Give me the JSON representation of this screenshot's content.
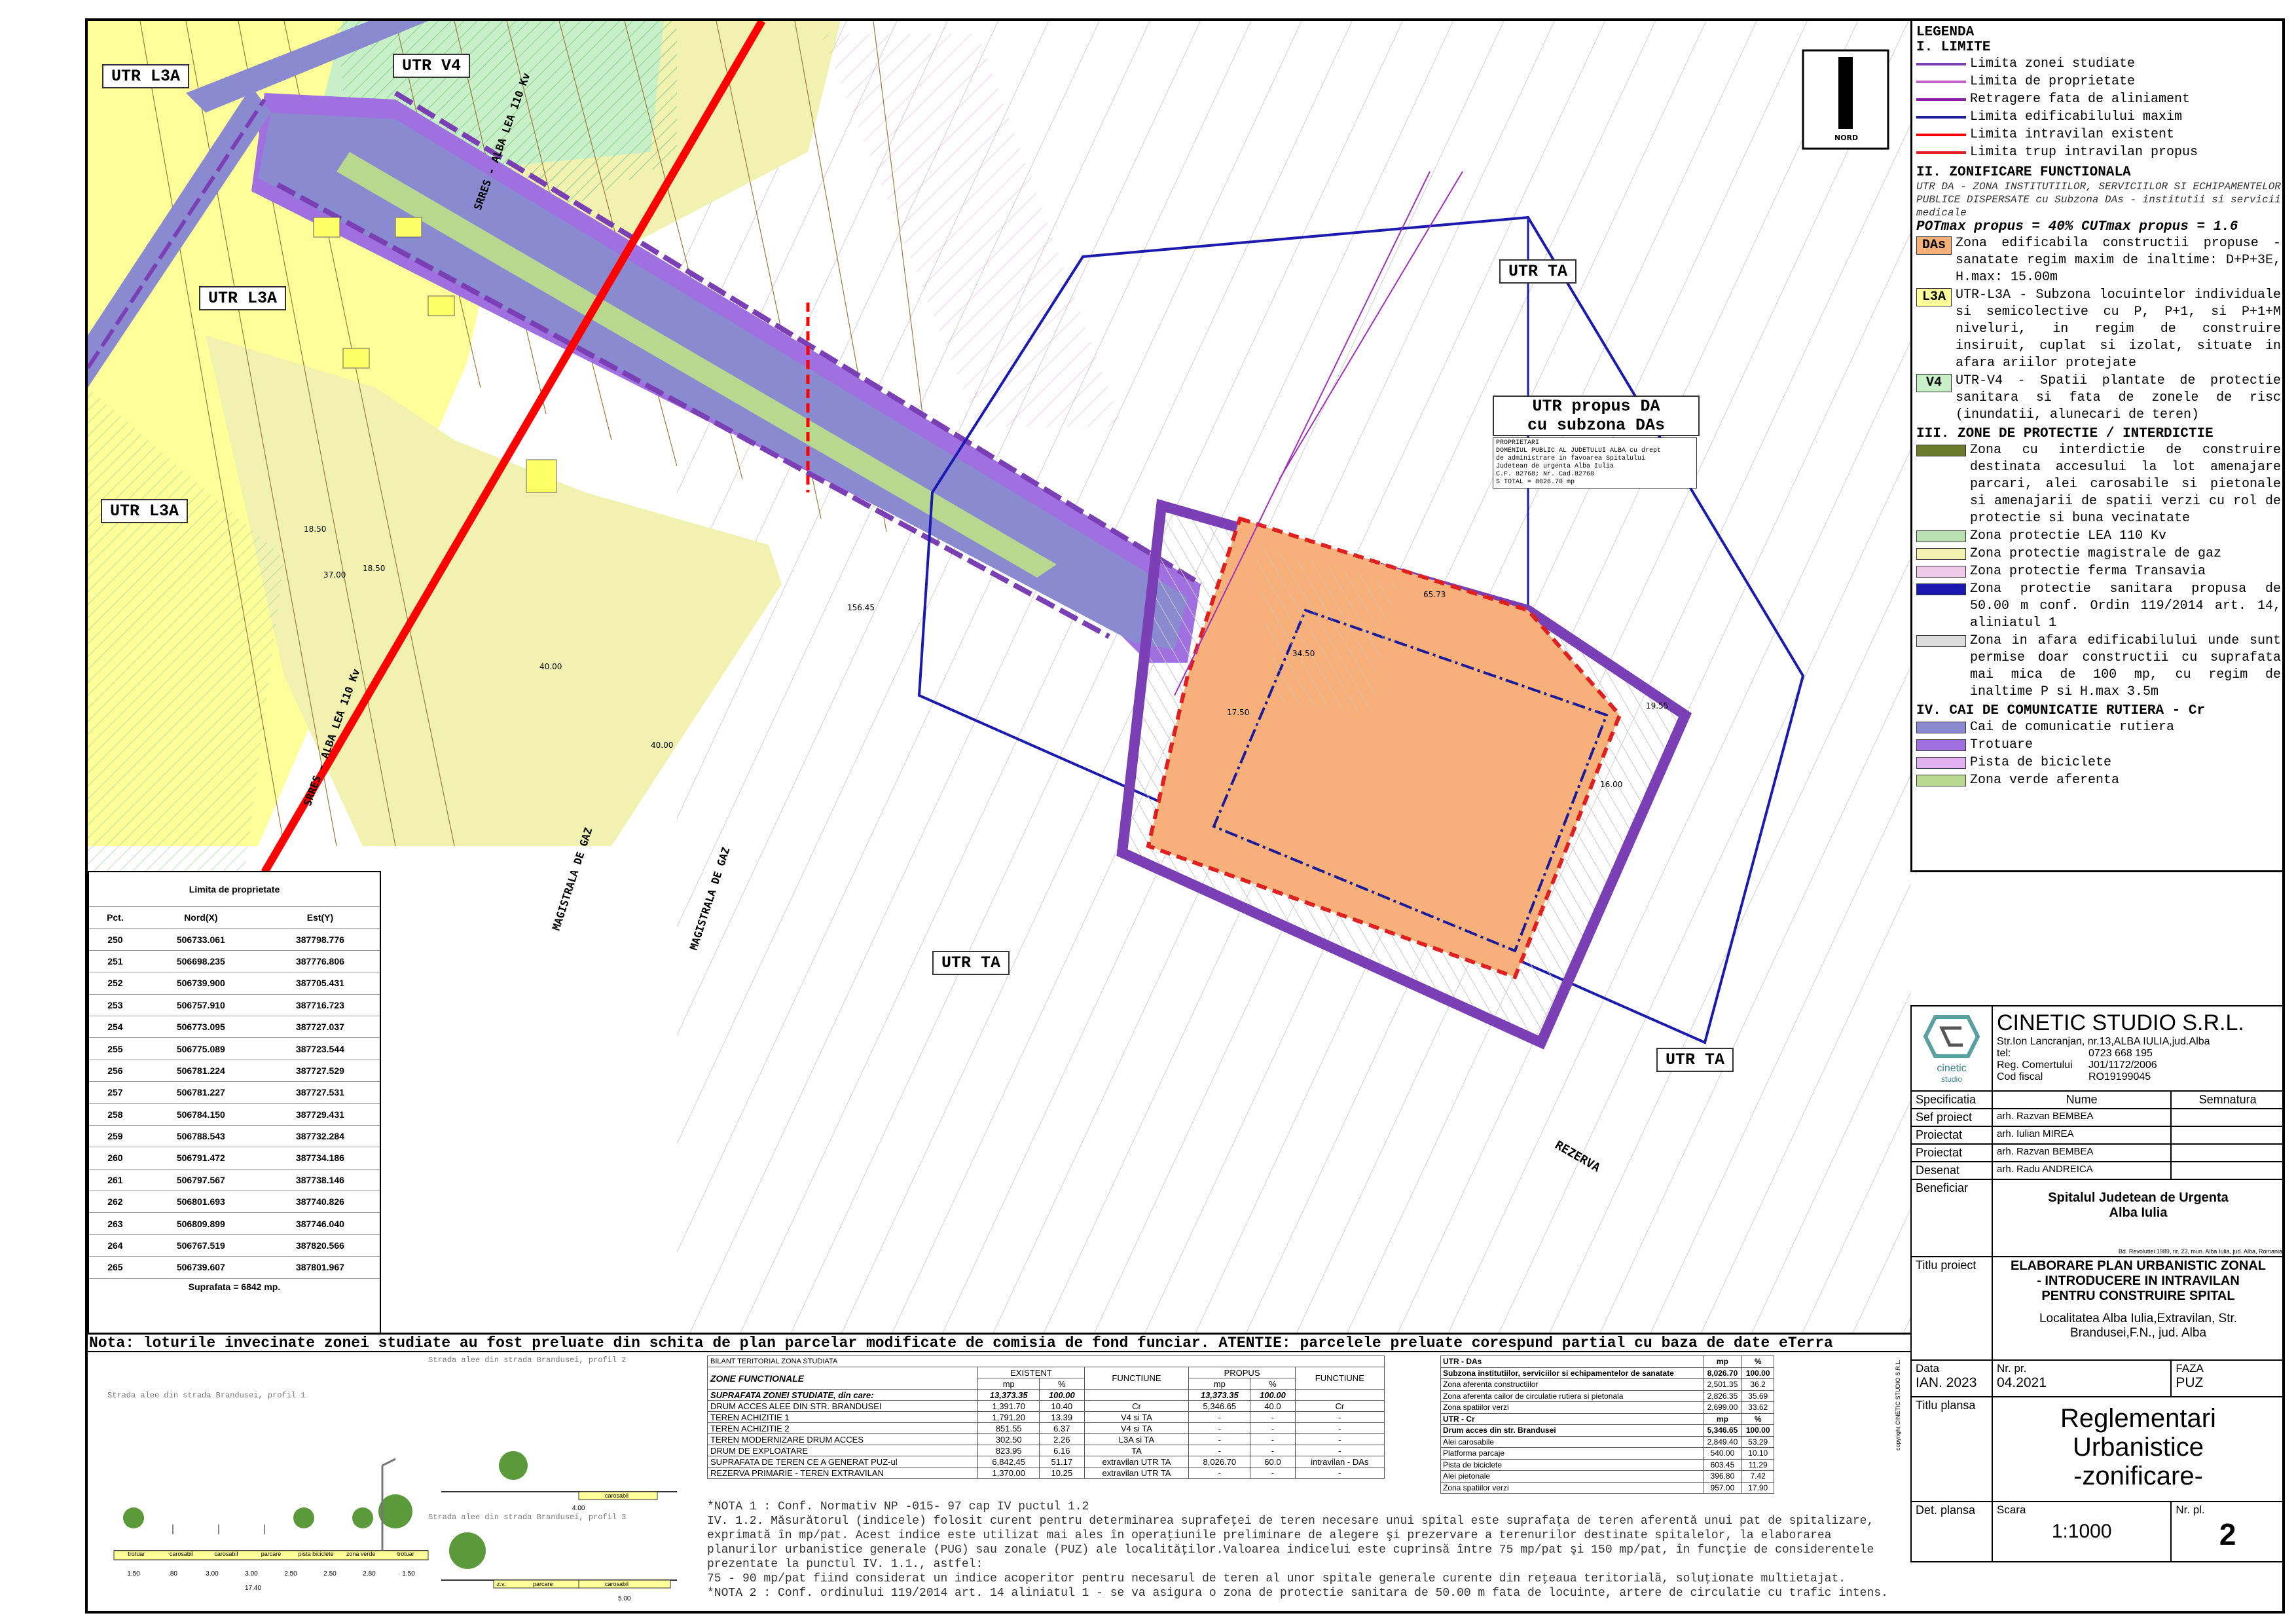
{
  "map": {
    "utr_labels": [
      "UTR L3A",
      "UTR V4",
      "UTR L3A",
      "UTR L3A",
      "UTR TA",
      "UTR TA",
      "UTR TA"
    ],
    "utr_propus": [
      "UTR propus DA",
      "cu subzona DAs"
    ],
    "owner_note": [
      "PROPRIETARI",
      "DOMENIUL PUBLIC AL JUDETULUI ALBA cu drept",
      "de administrare in favoarea Spitalului",
      "Judetean de urgenta Alba Iulia",
      "C.F. 82768; Nr. Cad.82768",
      "S TOTAL = 8026.70 mp"
    ],
    "line_labels": [
      "SRRES - ALBA LEA 110 Kv",
      "SRRES - ALBA LEA 110 Kv",
      "MAGISTRALA DE GAZ",
      "MAGISTRALA DE GAZ"
    ],
    "rezerva": "REZERVA",
    "north": "NORD",
    "dims": [
      "18.50",
      "37.00",
      "18.50",
      "40.00",
      "40.00",
      "34.50",
      "17.50",
      "19.55",
      "16.00",
      "156.45",
      "65.73"
    ]
  },
  "legend": {
    "title": "LEGENDA",
    "s1": "I. LIMITE",
    "limits": [
      {
        "label": "Limita zonei studiate",
        "color": "#7b3fb5"
      },
      {
        "label": "Limita de proprietate",
        "color": "#c060c8"
      },
      {
        "label": "Retragere fata de aliniament",
        "color": "#8b1fa8"
      },
      {
        "label": "Limita edificabilului maxim",
        "color": "#1a1a9a"
      },
      {
        "label": "Limita intravilan existent",
        "color": "#ff0000"
      },
      {
        "label": "Limita trup intravilan propus",
        "color": "#e02020"
      }
    ],
    "s2": "II. ZONIFICARE FUNCTIONALA",
    "s2_desc": "UTR DA - ZONA  INSTITUTIILOR, SERVICIILOR SI ECHIPAMENTELOR PUBLICE DISPERSATE cu Subzona DAs - institutii si servicii medicale",
    "pot": "POTmax propus = 40% CUTmax propus = 1.6",
    "zones": [
      {
        "code": "DAs",
        "label": "Zona edificabila constructii propuse - sanatate regim maxim de inaltime: D+P+3E, H.max: 15.00m",
        "color": "#f7b07a"
      },
      {
        "code": "L3A",
        "label": "UTR-L3A - Subzona locuintelor individuale si semicolective cu P, P+1, si P+1+M niveluri, in regim de construire insiruit, cuplat si izolat, situate in afara ariilor protejate",
        "color": "#ffff99"
      },
      {
        "code": "V4",
        "label": "UTR-V4 - Spatii plantate de protectie sanitara si fata de zonele de risc (inundatii, alunecari de teren)",
        "color": "#c8f0c8"
      }
    ],
    "s3": "III. ZONE DE PROTECTIE / INTERDICTIE",
    "protect": [
      {
        "label": "Zona cu interdictie de construire destinata accesului la lot amenajare parcari, alei carosabile si pietonale si amenajarii de spatii verzi cu rol de protectie si buna vecinatate",
        "color": "#6b7a2a"
      },
      {
        "label": "Zona protectie LEA 110 Kv",
        "color": "#b8e0b0"
      },
      {
        "label": "Zona protectie magistrale de gaz",
        "color": "#f2f2b0"
      },
      {
        "label": "Zona protectie ferma Transavia",
        "color": "#f0c8e8"
      },
      {
        "label": "Zona protectie sanitara propusa de 50.00 m conf. Ordin 119/2014 art. 14, aliniatul 1",
        "color": "#1a1ab0"
      },
      {
        "label": "Zona in afara edificabilului unde sunt permise doar constructii cu suprafata mai mica de 100 mp, cu regim de inaltime P si H.max 3.5m",
        "color": "#dddddd"
      }
    ],
    "s4": "IV. CAI DE COMUNICATIE RUTIERA - Cr",
    "roads": [
      {
        "label": "Cai de comunicatie rutiera",
        "color": "#8a8ad0"
      },
      {
        "label": "Trotuare",
        "color": "#a070e0"
      },
      {
        "label": "Pista de biciclete",
        "color": "#e0b0f0"
      },
      {
        "label": "Zona verde aferenta",
        "color": "#b8d890"
      }
    ]
  },
  "coords": {
    "title": "Limita de proprietate",
    "headers": [
      "Pct.",
      "Nord(X)",
      "Est(Y)"
    ],
    "rows": [
      [
        "250",
        "506733.061",
        "387798.776"
      ],
      [
        "251",
        "506698.235",
        "387776.806"
      ],
      [
        "252",
        "506739.900",
        "387705.431"
      ],
      [
        "253",
        "506757.910",
        "387716.723"
      ],
      [
        "254",
        "506773.095",
        "387727.037"
      ],
      [
        "255",
        "506775.089",
        "387723.544"
      ],
      [
        "256",
        "506781.224",
        "387727.529"
      ],
      [
        "257",
        "506781.227",
        "387727.531"
      ],
      [
        "258",
        "506784.150",
        "387729.431"
      ],
      [
        "259",
        "506788.543",
        "387732.284"
      ],
      [
        "260",
        "506791.472",
        "387734.186"
      ],
      [
        "261",
        "506797.567",
        "387738.146"
      ],
      [
        "262",
        "506801.693",
        "387740.826"
      ],
      [
        "263",
        "506809.899",
        "387746.040"
      ],
      [
        "264",
        "506767.519",
        "387820.566"
      ],
      [
        "265",
        "506739.607",
        "387801.967"
      ]
    ],
    "total": "Suprafata = 6842 mp."
  },
  "note_line": "Nota: loturile invecinate zonei studiate au fost preluate din schita de plan parcelar modificate de comisia de fond funciar. ATENTIE: parcelele preluate corespund partial cu baza de date eTerra",
  "profiles": {
    "p1_title": "Strada alee din strada Brandusei, profil 1",
    "p2_title": "Strada alee din strada Brandusei, profil 2",
    "p3_title": "Strada alee din strada Brandusei, profil 3",
    "p1_labels": [
      "trotuar",
      "carosabil",
      "carosabil",
      "parcare",
      "pista biciclete",
      "zona verde",
      "trotuar"
    ],
    "p1_dims": [
      "1.50",
      ".80",
      "3.00",
      "3.00",
      "2.50",
      "2.50",
      "2.80",
      "1.50"
    ],
    "p1_total": "17.40",
    "p2_label": "carosabil",
    "p2_dim": "4.00",
    "p3_labels": [
      "z.v.",
      "parcare",
      "carosabil"
    ],
    "p3_dim": "5.00"
  },
  "bilant": {
    "title": "BILANT TERITORIAL ZONA STUDIATA",
    "zone_head": "ZONE FUNCTIONALE",
    "cols": [
      "EXISTENT",
      "FUNCTIUNE",
      "PROPUS",
      "FUNCTIUNE"
    ],
    "units": [
      "mp",
      "%",
      "mp",
      "%"
    ],
    "rows": [
      [
        "SUPRAFATA ZONEI STUDIATE, din care:",
        "13,373.35",
        "100.00",
        "",
        "13,373.35",
        "100.00",
        ""
      ],
      [
        "DRUM ACCES ALEE DIN STR. BRANDUSEI",
        "1,391.70",
        "10.40",
        "Cr",
        "5,346.65",
        "40.0",
        "Cr"
      ],
      [
        "TEREN ACHIZITIE 1",
        "1,791.20",
        "13.39",
        "V4 si TA",
        "-",
        "-",
        "-"
      ],
      [
        "TEREN ACHIZITIE 2",
        "851.55",
        "6.37",
        "V4 si TA",
        "-",
        "-",
        "-"
      ],
      [
        "TEREN MODERNIZARE DRUM ACCES",
        "302.50",
        "2.26",
        "L3A si TA",
        "-",
        "-",
        "-"
      ],
      [
        "DRUM DE EXPLOATARE",
        "823.95",
        "6.16",
        "TA",
        "-",
        "-",
        "-"
      ],
      [
        "SUPRAFATA DE TEREN CE A GENERAT PUZ-ul",
        "6,842.45",
        "51.17",
        "extravilan UTR TA",
        "8,026.70",
        "60.0",
        "intravilan - DAs"
      ],
      [
        "REZERVA PRIMARIE - TEREN EXTRAVILAN",
        "1,370.00",
        "10.25",
        "extravilan UTR TA",
        "-",
        "-",
        "-"
      ]
    ]
  },
  "utr_table": {
    "head1": [
      "UTR - DAs",
      "mp",
      "%"
    ],
    "rows1": [
      [
        "Subzona institutiilor, serviciilor si echipamentelor de sanatate",
        "8,026.70",
        "100.00"
      ],
      [
        "Zona aferenta constructiilor",
        "2,501.35",
        "36.2"
      ],
      [
        "Zona aferenta cailor de circulatie rutiera si pietonala",
        "2,826.35",
        "35.69"
      ],
      [
        "Zona spatiilor verzi",
        "2,699.00",
        "33.62"
      ]
    ],
    "head2": [
      "UTR - Cr",
      "mp",
      "%"
    ],
    "rows2": [
      [
        "Drum acces din str. Brandusei",
        "5,346.65",
        "100.00"
      ],
      [
        "Alei carosabile",
        "2,849.40",
        "53.29"
      ],
      [
        "Platforma parcaje",
        "540.00",
        "10.10"
      ],
      [
        "Pista de biciclete",
        "603.45",
        "11.29"
      ],
      [
        "Alei pietonale",
        "396.80",
        "7.42"
      ],
      [
        "Zona spatiilor verzi",
        "957.00",
        "17.90"
      ]
    ]
  },
  "notes": [
    "*NOTA 1 : Conf. Normativ NP -015- 97 cap IV puctul 1.2",
    "IV. 1.2. Măsurătorul (indicele) folosit curent pentru determinarea suprafeţei de teren necesare unui spital este suprafaţa de teren aferentă unui pat de spitalizare, exprimată în mp/pat. Acest indice este utilizat mai ales în operaţiunile preliminare de alegere şi prezervare a terenurilor destinate spitalelor, la elaborarea planurilor urbanistice generale (PUG) sau zonale (PUZ) ale localităţilor.Valoarea indicelui este cuprinsă între 75 mp/pat şi 150 mp/pat, în funcţie de considerentele prezentate la punctul IV. 1.1., astfel:",
    "75 - 90 mp/pat fiind considerat un indice acoperitor pentru necesarul de teren al unor spitale generale curente din reţeaua teritorială, soluţionate multietajat.",
    "*NOTA 2 : Conf. ordinului 119/2014 art. 14 aliniatul 1 -  se va asigura o zona de protectie sanitara de 50.00 m fata de locuinte, artere de circulatie cu trafic intens."
  ],
  "title_block": {
    "company": "CINETIC STUDIO S.R.L.",
    "logo_text": "cinetic",
    "logo_sub": "studio",
    "address": "Str.Ion Lancranjan, nr.13,ALBA IULIA,jud.Alba",
    "tel_label": "tel:",
    "tel": "0723 668 195",
    "reg_label": "Reg. Comertului",
    "reg": "J01/1172/2006",
    "cf_label": "Cod fiscal",
    "cf": "RO19199045",
    "spec_head": [
      "Specificatia",
      "Nume",
      "Semnatura"
    ],
    "staff": [
      [
        "Sef proiect",
        "arh. Razvan BEMBEA"
      ],
      [
        "Proiectat",
        "arh. Iulian MIREA"
      ],
      [
        "Proiectat",
        "arh. Razvan BEMBEA"
      ],
      [
        "Desenat",
        "arh. Radu ANDREICA"
      ]
    ],
    "beneficiar_label": "Beneficiar",
    "beneficiar": [
      "Spitalul Judetean de Urgenta",
      "Alba Iulia"
    ],
    "beneficiar_addr": "Bd. Revolutiei 1989, nr. 23, mun. Alba Iulia, jud. Alba, Romania",
    "titlu_proiect_label": "Titlu proiect",
    "titlu_proiect": [
      "ELABORARE PLAN URBANISTIC ZONAL",
      "- INTRODUCERE IN INTRAVILAN",
      "PENTRU CONSTRUIRE SPITAL"
    ],
    "locatie": [
      "Localitatea Alba Iulia,Extravilan, Str.",
      "Brandusei,F.N., jud. Alba"
    ],
    "data_label": "Data",
    "data": "IAN. 2023",
    "nrpr_label": "Nr. pr.",
    "nrpr": "04.2021",
    "faza_label": "FAZA",
    "faza": "PUZ",
    "titlu_plansa_label": "Titlu plansa",
    "titlu_plansa": [
      "Reglementari",
      "Urbanistice",
      "-zonificare-"
    ],
    "det_label": "Det. plansa",
    "scara_label": "Scara",
    "scara": "1:1000",
    "nrpl_label": "Nr. pl.",
    "nrpl": "2",
    "copyright": "copyright CINETIC STUDIO S.R.L."
  },
  "colors": {
    "road": "#8a8ad0",
    "sidewalk": "#a070e0",
    "bike": "#e0b0f0",
    "green": "#b8d890",
    "l3a": "#ffff99",
    "v4": "#c8f0c8",
    "das": "#f7b07a",
    "intravilan": "#ff0000",
    "protect_blue": "#1a1ab0"
  }
}
